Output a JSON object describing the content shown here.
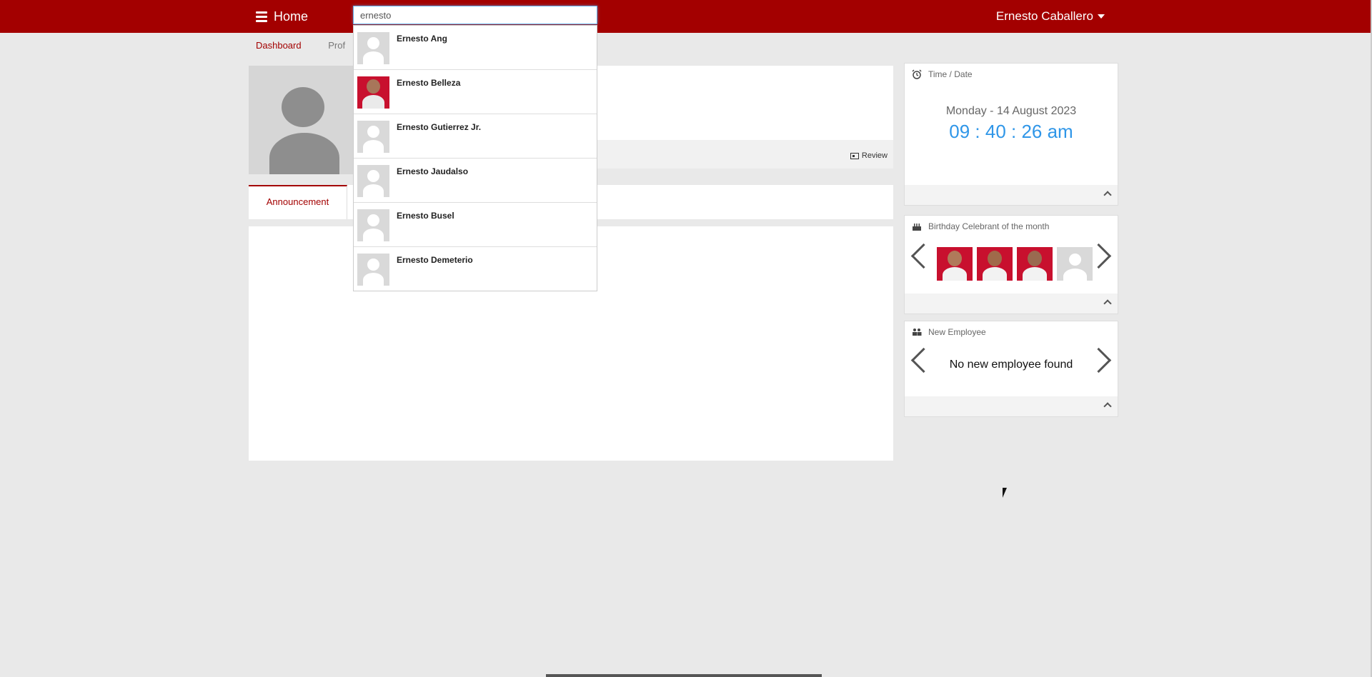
{
  "nav": {
    "home_label": "Home",
    "user_name": "Ernesto Caballero",
    "search_value": "ernesto"
  },
  "subnav": {
    "dashboard": "Dashboard",
    "profile": "Prof"
  },
  "profile": {
    "review_label": "Review"
  },
  "tabs": {
    "announcement": "Announcement"
  },
  "search_results": [
    {
      "name": "Ernesto Ang",
      "photo": "placeholder"
    },
    {
      "name": "Ernesto Belleza",
      "photo": "red-photo"
    },
    {
      "name": "Ernesto Gutierrez Jr.",
      "photo": "placeholder"
    },
    {
      "name": "Ernesto Jaudalso",
      "photo": "placeholder"
    },
    {
      "name": "Ernesto Busel",
      "photo": "placeholder"
    },
    {
      "name": "Ernesto Demeterio",
      "photo": "placeholder"
    }
  ],
  "widgets": {
    "time_date": {
      "title": "Time / Date",
      "date": "Monday - 14 August 2023",
      "time": "09 : 40 : 26 am"
    },
    "birthday": {
      "title": "Birthday Celebrant of the month"
    },
    "new_employee": {
      "title": "New Employee",
      "empty_message": "No new employee found"
    }
  },
  "colors": {
    "brand": "#a30000",
    "clock": "#2f96e8"
  }
}
